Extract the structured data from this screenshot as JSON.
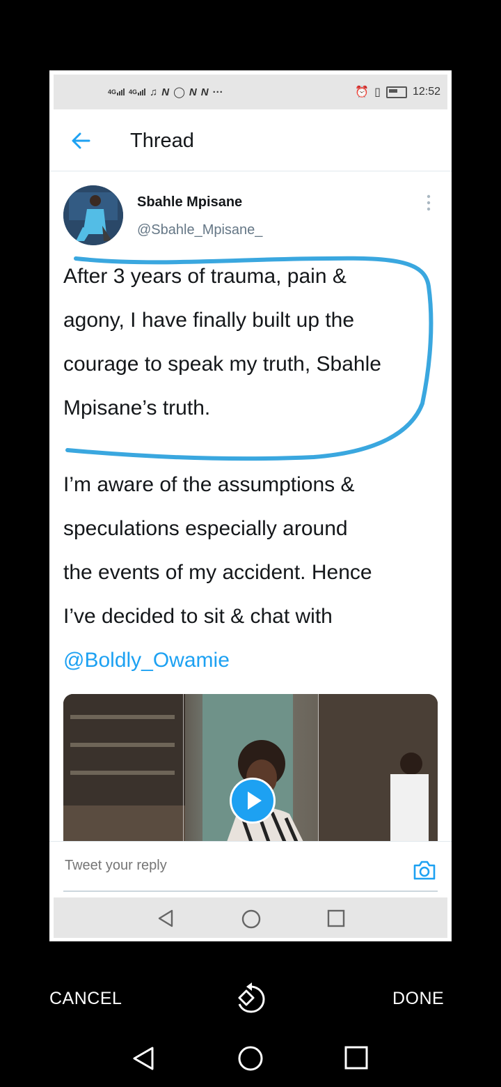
{
  "status_bar": {
    "network_1": "4G",
    "network_2": "4G",
    "time": "12:52",
    "notification_icons": [
      "music-note-icon",
      "netflix-icon",
      "whatsapp-icon",
      "netflix-icon",
      "netflix-icon",
      "more-dots-icon"
    ],
    "system_icons": [
      "alarm-icon",
      "vibrate-icon",
      "battery-icon"
    ]
  },
  "header": {
    "title": "Thread",
    "back_icon": "arrow-left-icon"
  },
  "tweet": {
    "author_name": "Sbahle Mpisane",
    "author_handle": "@Sbahle_Mpisane_",
    "paragraph_1": "After 3 years of trauma, pain &\nagony, I have finally built up the\ncourage to speak my truth, Sbahle\nMpisane’s truth.",
    "paragraph_2": "I’m aware of the assumptions &\nspeculations especially around\nthe events of my accident. Hence\nI’ve  decided to sit & chat with",
    "mention": "@Boldly_Owamie",
    "annotation_color": "#3aa7df"
  },
  "reply": {
    "placeholder": "Tweet your reply",
    "camera_icon": "camera-icon"
  },
  "editor_bar": {
    "cancel_label": "CANCEL",
    "done_label": "DONE",
    "rotate_icon": "rotate-icon"
  },
  "colors": {
    "accent": "#1da1f2",
    "text": "#14171a",
    "secondary": "#657786"
  }
}
